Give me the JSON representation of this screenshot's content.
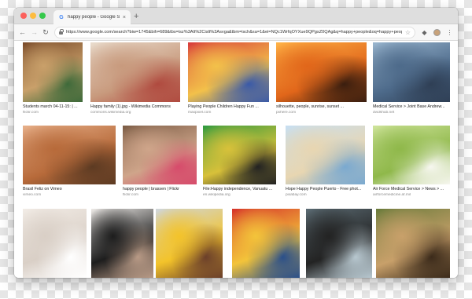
{
  "browser": {
    "tab_title": "happy people - Google Search",
    "tab_close": "×",
    "new_tab": "+",
    "url": "https://www.google.com/search?biw=1745&bih=689&tbs=isz%3Alt%2Cislt%3Asvga&tbm=isch&sa=1&ei=NQc1WrfqOYXue9QPgsZ0QAg&q=happy+people&oq=happy+people&gs_l=img.3..0i67k1l3.0...",
    "icons": [
      "back-icon",
      "forward-icon",
      "reload-icon",
      "lock-icon",
      "bookmark-star-icon",
      "extension-icon",
      "menu-icon"
    ],
    "traffic_colors": [
      "#fc605c",
      "#fdbc40",
      "#34c84a"
    ]
  },
  "results": [
    {
      "title": "Students march 04-11-15: | ...",
      "source": "flickr.com",
      "colors": [
        "#7a4b2a",
        "#c9a06a",
        "#3e6a3a"
      ]
    },
    {
      "title": "Happy family (1).jpg - Wikimedia Commons",
      "source": "commons.wikimedia.org",
      "colors": [
        "#e9dccd",
        "#c89a7d",
        "#b04a3f"
      ]
    },
    {
      "title": "Playing People Children Happy Fun ...",
      "source": "maxpixel.com",
      "colors": [
        "#d83b3b",
        "#f3c14a",
        "#3a5aa8"
      ]
    },
    {
      "title": "silhouette, people, sunrise, sunset ...",
      "source": "pxhere.com",
      "colors": [
        "#ffb347",
        "#e1661a",
        "#3a1e0f"
      ]
    },
    {
      "title": "Medical Service > Joint Base Andrew...",
      "source": "dvidshub.net",
      "colors": [
        "#9ab6cf",
        "#4d6a8a",
        "#2f3f55"
      ]
    },
    {
      "title": "Brasil Feliz on Vimeo",
      "source": "vimeo.com",
      "colors": [
        "#e7b08a",
        "#b76a3a",
        "#5c3a22"
      ]
    },
    {
      "title": "happy people | brassen | Flickr",
      "source": "flickr.com",
      "colors": [
        "#7b5c45",
        "#cfa58a",
        "#d74b6b"
      ]
    },
    {
      "title": "File:Happy independence, Vanuatu ...",
      "source": "en.wikipedia.org",
      "colors": [
        "#2f9a3f",
        "#d8c13a",
        "#222222"
      ]
    },
    {
      "title": "Hope Happy People Puerto - Free phot...",
      "source": "pixabay.com",
      "colors": [
        "#c7dff2",
        "#e8d6b1",
        "#7aa9d0"
      ]
    },
    {
      "title": "Air Force Medical Service > News > ...",
      "source": "airforcemedicine.af.mil",
      "colors": [
        "#cfe49c",
        "#8fb84a",
        "#f7f7f0"
      ]
    },
    {
      "title": "",
      "source": "",
      "colors": [
        "#f2ece6",
        "#d9cfc6",
        "#ffffff"
      ]
    },
    {
      "title": "",
      "source": "",
      "colors": [
        "#ece9e6",
        "#1d1d1d",
        "#b89a86"
      ]
    },
    {
      "title": "",
      "source": "",
      "colors": [
        "#cfd6dc",
        "#f3c32a",
        "#6b3f2a"
      ]
    },
    {
      "title": "",
      "source": "",
      "colors": [
        "#d6332a",
        "#f3c43a",
        "#2a4f8a"
      ]
    },
    {
      "title": "",
      "source": "",
      "colors": [
        "#5b6b73",
        "#232323",
        "#b8c8d0"
      ]
    },
    {
      "title": "",
      "source": "",
      "colors": [
        "#6a7b3b",
        "#c8a06a",
        "#3b2a1a"
      ]
    }
  ]
}
